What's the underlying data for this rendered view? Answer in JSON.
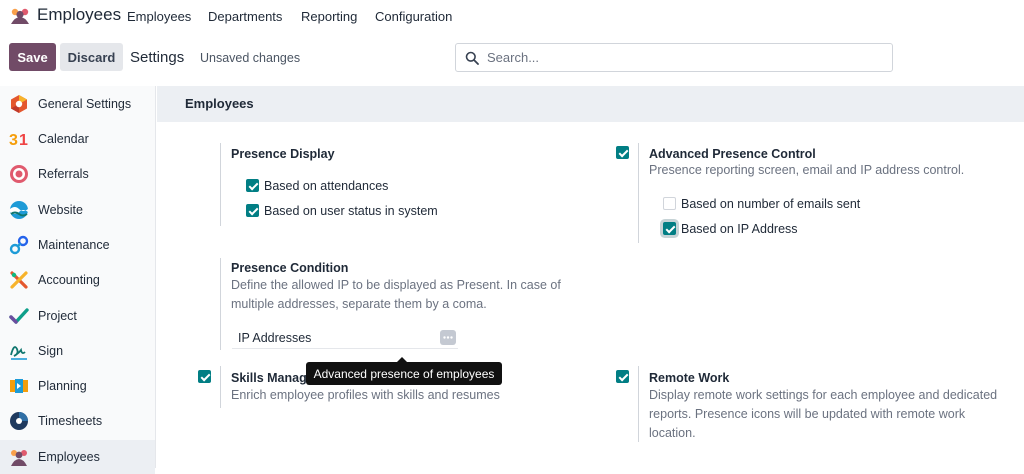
{
  "app": {
    "name": "Employees",
    "logo_icon": "employees-app-icon"
  },
  "navbar": {
    "menu": [
      "Employees",
      "Departments",
      "Reporting",
      "Configuration"
    ]
  },
  "control_panel": {
    "save_label": "Save",
    "discard_label": "Discard",
    "breadcrumb": "Settings",
    "status": "Unsaved changes",
    "search_placeholder": "Search..."
  },
  "sidebar": {
    "items": [
      {
        "label": "General Settings",
        "icon": "general-settings-icon",
        "active": false
      },
      {
        "label": "Calendar",
        "icon": "calendar-icon",
        "active": false
      },
      {
        "label": "Referrals",
        "icon": "referrals-icon",
        "active": false
      },
      {
        "label": "Website",
        "icon": "website-icon",
        "active": false
      },
      {
        "label": "Maintenance",
        "icon": "maintenance-icon",
        "active": false
      },
      {
        "label": "Accounting",
        "icon": "accounting-icon",
        "active": false
      },
      {
        "label": "Project",
        "icon": "project-icon",
        "active": false
      },
      {
        "label": "Sign",
        "icon": "sign-icon",
        "active": false
      },
      {
        "label": "Planning",
        "icon": "planning-icon",
        "active": false
      },
      {
        "label": "Timesheets",
        "icon": "timesheets-icon",
        "active": false
      },
      {
        "label": "Employees",
        "icon": "employees-icon",
        "active": true
      }
    ]
  },
  "section": {
    "title": "Employees",
    "presence_display": {
      "title": "Presence Display",
      "options": [
        {
          "label": "Based on attendances",
          "checked": true
        },
        {
          "label": "Based on user status in system",
          "checked": true
        }
      ]
    },
    "advanced_presence": {
      "title": "Advanced Presence Control",
      "checked": true,
      "description": "Presence reporting screen, email and IP address control.",
      "options": [
        {
          "label": "Based on number of emails sent",
          "checked": false
        },
        {
          "label": "Based on IP Address",
          "checked": true
        }
      ]
    },
    "presence_condition": {
      "title": "Presence Condition",
      "description": "Define the allowed IP to be displayed as Present. In case of multiple addresses, separate them by a coma.",
      "field_label": "IP Addresses",
      "field_value": ""
    },
    "skills": {
      "title": "Skills Manag",
      "checked": true,
      "description": "Enrich employee profiles with skills and resumes"
    },
    "remote_work": {
      "title": "Remote Work",
      "checked": true,
      "description": "Display remote work settings for each employee and dedicated reports. Presence icons will be updated with remote work location."
    },
    "tooltip": "Advanced presence of employees"
  },
  "colors": {
    "brand": "#714b67",
    "checkbox": "#017e84"
  }
}
